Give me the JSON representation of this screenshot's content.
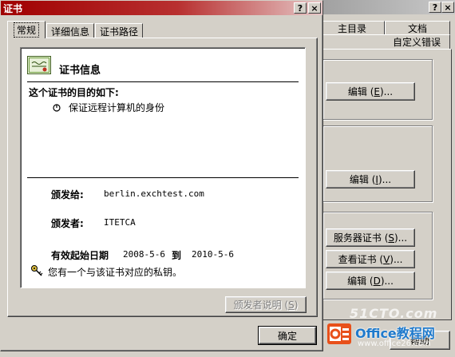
{
  "back_window": {
    "tabs_row1": [
      "主目录",
      "文档"
    ],
    "tabs_row2": [
      "自定义错误"
    ],
    "buttons": [
      "编辑(E)...",
      "编辑(I)...",
      "服务器证书(S)...",
      "查看证书(V)...",
      "编辑(D)..."
    ],
    "help_label": "帮助"
  },
  "dialog": {
    "title": "证书",
    "help_glyph": "?",
    "close_glyph": "×",
    "tabs": [
      "常规",
      "详细信息",
      "证书路径"
    ],
    "info_title": "证书信息",
    "purpose_heading": "这个证书的目的如下:",
    "purposes": [
      "保证远程计算机的身份"
    ],
    "issued_to_label": "颁发给:",
    "issued_to_value": "berlin.exchtest.com",
    "issued_by_label": "颁发者:",
    "issued_by_value": "ITETCA",
    "valid_from_label": "有效起始日期",
    "valid_from_value": "2008-5-6",
    "valid_to_label": "到",
    "valid_to_value": "2010-5-6",
    "private_key_note": "您有一个与该证书对应的私钥。",
    "issuer_statement_button": "颁发者说明(S)",
    "ok_button": "确定"
  },
  "watermark": {
    "site": "51CTO.com",
    "brand": "Office教程网",
    "url": "www.office26.com"
  },
  "colors": {
    "title_active": "#a00000",
    "title_gradient_end": "#e6c8c8",
    "face": "#d4d0c8"
  }
}
